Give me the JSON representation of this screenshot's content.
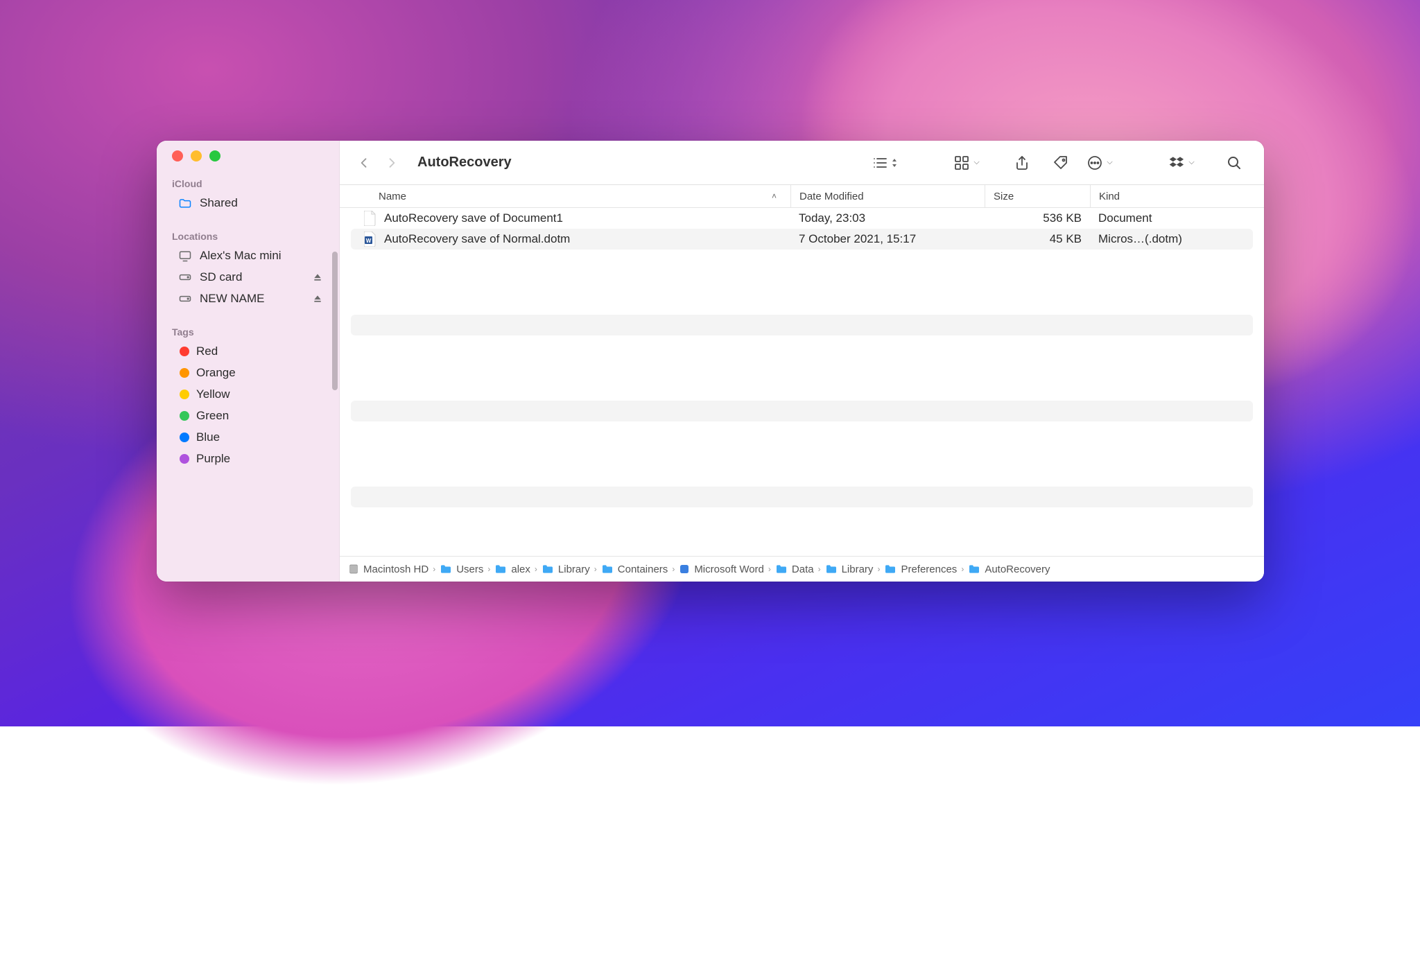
{
  "window_title": "AutoRecovery",
  "sidebar": {
    "icloud_label": "iCloud",
    "shared_label": "Shared",
    "locations_label": "Locations",
    "locations": [
      {
        "label": "Alex's Mac mini",
        "eject": false,
        "icon": "desktop"
      },
      {
        "label": "SD card",
        "eject": true,
        "icon": "drive"
      },
      {
        "label": "NEW NAME",
        "eject": true,
        "icon": "drive"
      }
    ],
    "tags_label": "Tags",
    "tags": [
      {
        "label": "Red",
        "color": "#ff3b30"
      },
      {
        "label": "Orange",
        "color": "#ff9500"
      },
      {
        "label": "Yellow",
        "color": "#ffcc00"
      },
      {
        "label": "Green",
        "color": "#34c759"
      },
      {
        "label": "Blue",
        "color": "#007aff"
      },
      {
        "label": "Purple",
        "color": "#af52de"
      }
    ]
  },
  "columns": {
    "name": "Name",
    "date": "Date Modified",
    "size": "Size",
    "kind": "Kind"
  },
  "rows": [
    {
      "name": "AutoRecovery save of Document1",
      "date": "Today, 23:03",
      "size": "536 KB",
      "kind": "Document",
      "icon": "doc"
    },
    {
      "name": "AutoRecovery save of Normal.dotm",
      "date": "7 October 2021, 15:17",
      "size": "45 KB",
      "kind": "Micros…(.dotm)",
      "icon": "word"
    }
  ],
  "path": [
    {
      "label": "Macintosh HD",
      "icon": "hdd"
    },
    {
      "label": "Users",
      "icon": "folder"
    },
    {
      "label": "alex",
      "icon": "folder"
    },
    {
      "label": "Library",
      "icon": "folder"
    },
    {
      "label": "Containers",
      "icon": "folder"
    },
    {
      "label": "Microsoft Word",
      "icon": "app"
    },
    {
      "label": "Data",
      "icon": "folder"
    },
    {
      "label": "Library",
      "icon": "folder"
    },
    {
      "label": "Preferences",
      "icon": "folder"
    },
    {
      "label": "AutoRecovery",
      "icon": "folder"
    }
  ]
}
